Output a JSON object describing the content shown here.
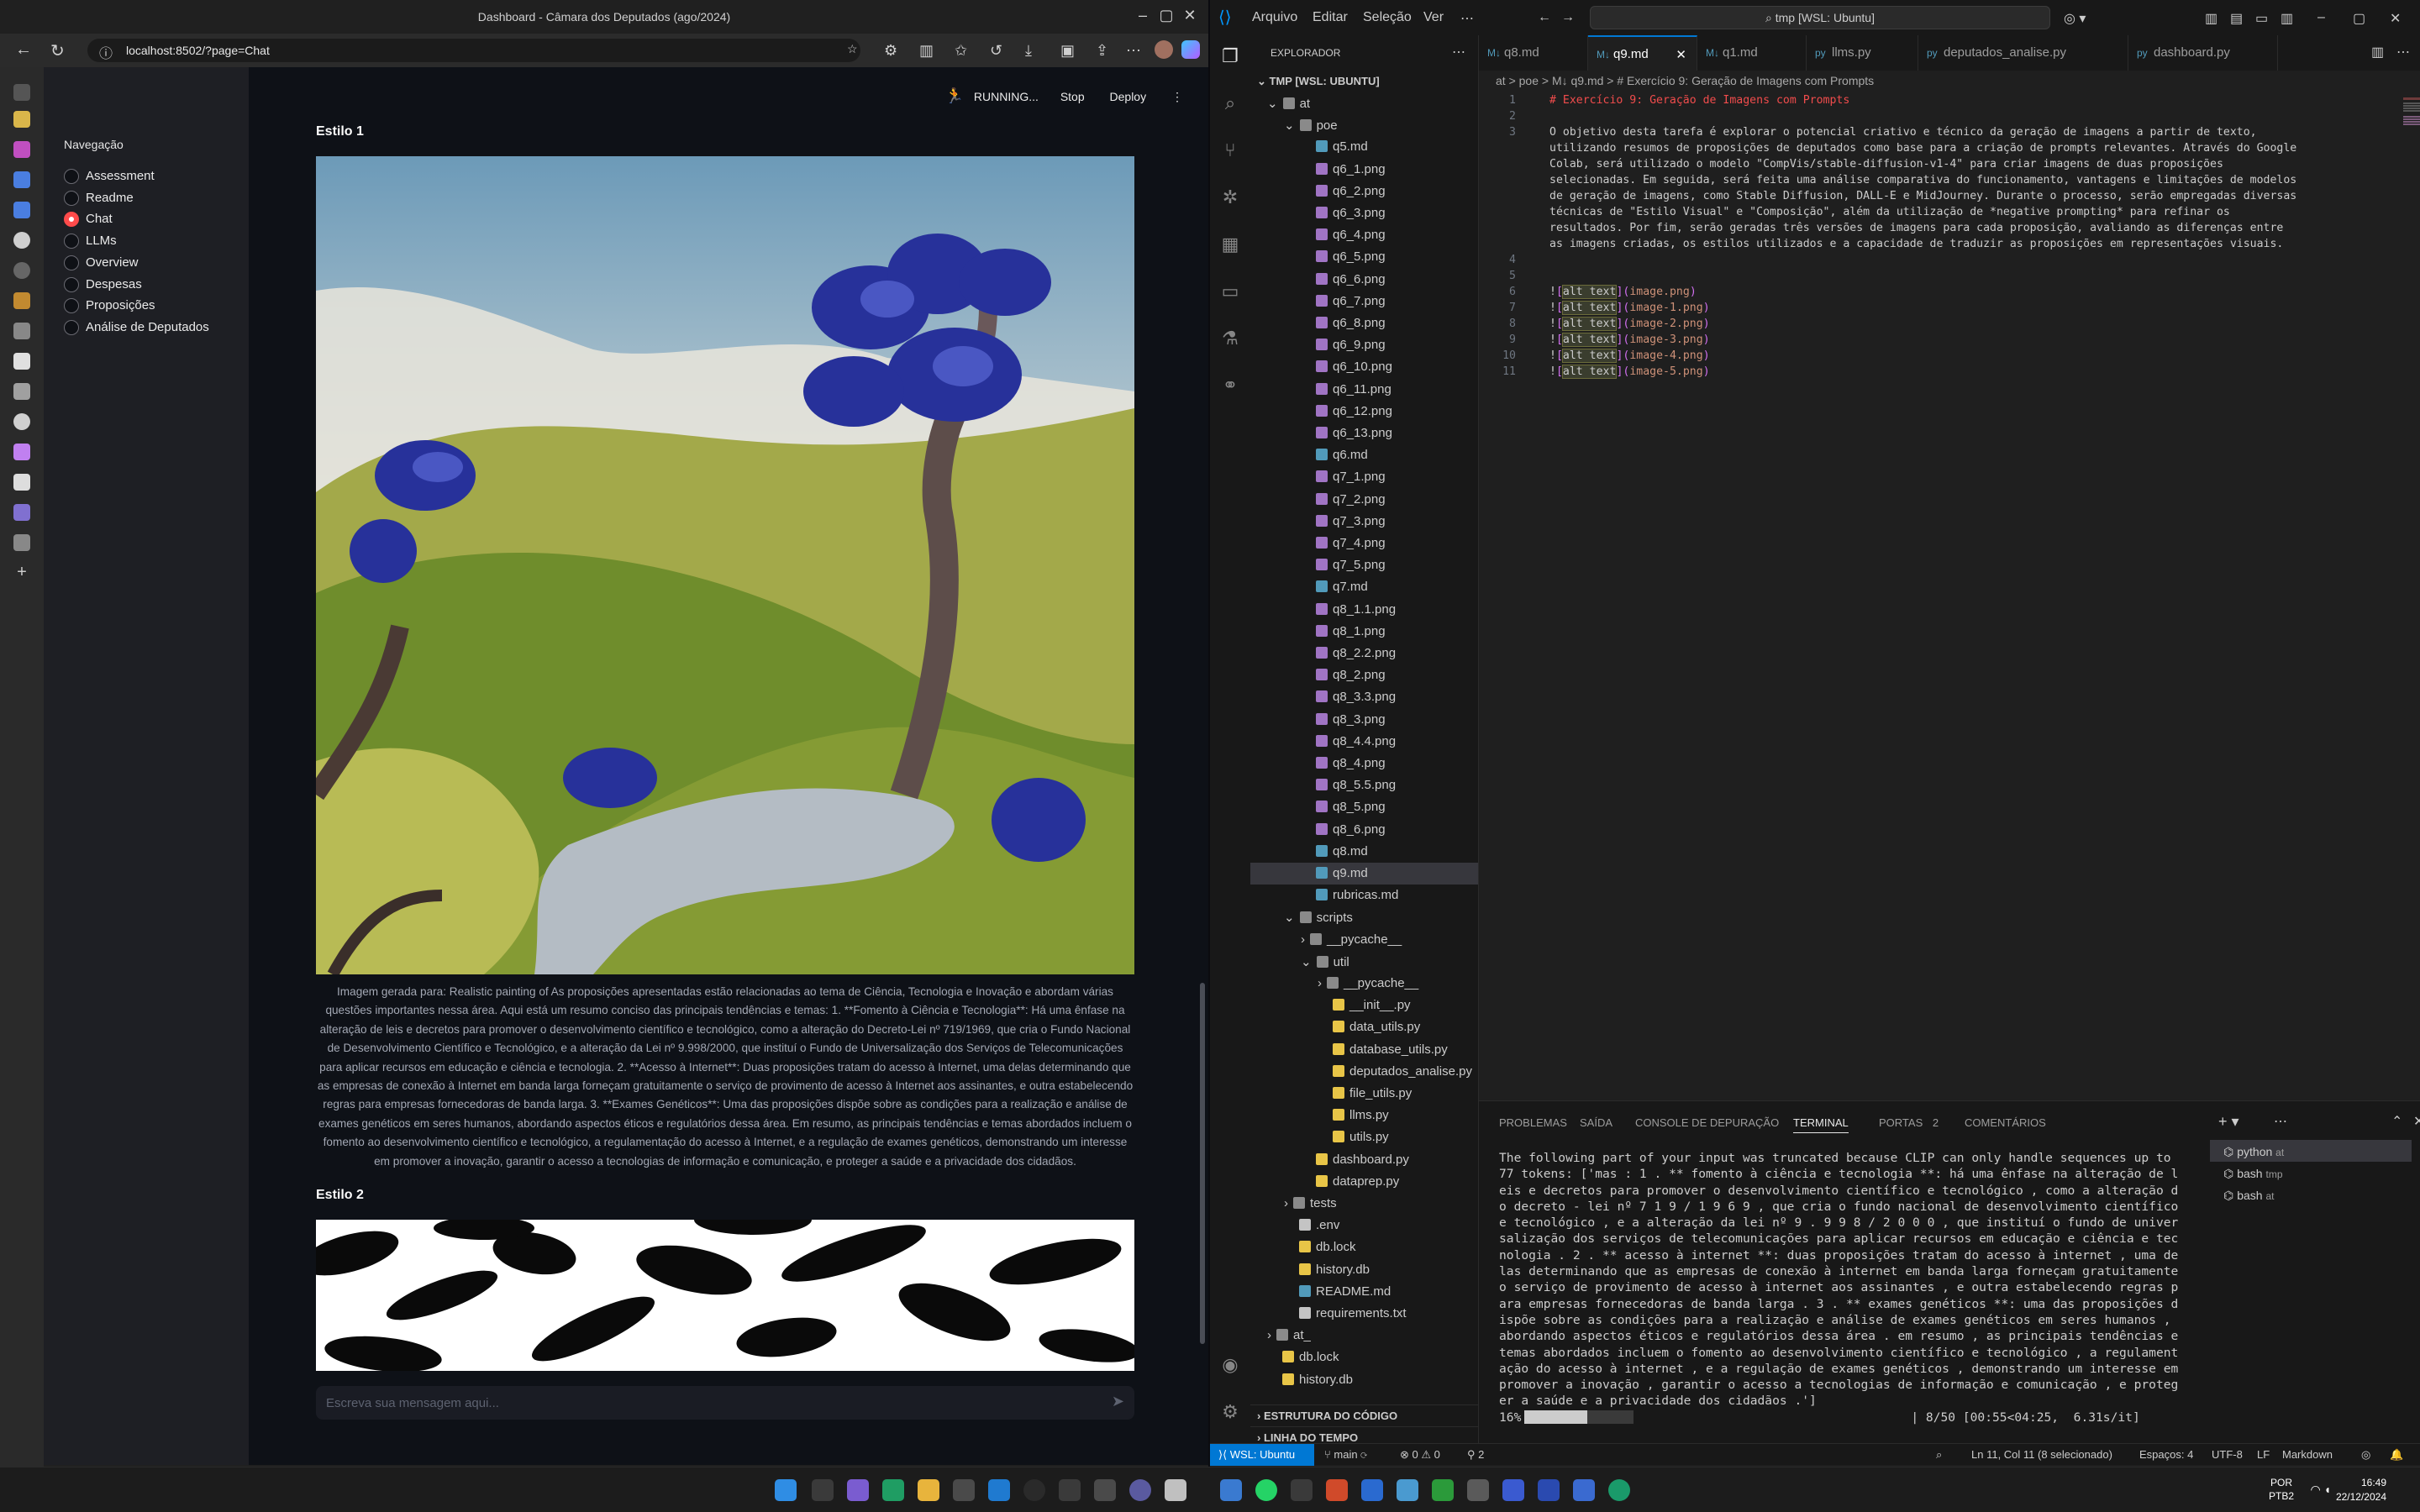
{
  "browser": {
    "window_title": "Dashboard - Câmara dos Deputados (ago/2024)",
    "url": "localhost:8502/?page=Chat"
  },
  "streamlit": {
    "status": "RUNNING...",
    "stop_label": "Stop",
    "deploy_label": "Deploy",
    "nav_heading": "Navegação",
    "nav_items": [
      "Assessment",
      "Readme",
      "Chat",
      "LLMs",
      "Overview",
      "Despesas",
      "Proposições",
      "Análise de Deputados"
    ],
    "nav_selected": "Chat",
    "style1_heading": "Estilo 1",
    "style2_heading": "Estilo 2",
    "caption": "Imagem gerada para: Realistic painting of As proposições apresentadas estão relacionadas ao tema de Ciência, Tecnologia e Inovação e abordam várias questões importantes nessa área. Aqui está um resumo conciso das principais tendências e temas: 1. **Fomento à Ciência e Tecnologia**: Há uma ênfase na alteração de leis e decretos para promover o desenvolvimento científico e tecnológico, como a alteração do Decreto-Lei nº 719/1969, que cria o Fundo Nacional de Desenvolvimento Científico e Tecnológico, e a alteração da Lei nº 9.998/2000, que instituí o Fundo de Universalização dos Serviços de Telecomunicações para aplicar recursos em educação e ciência e tecnologia. 2. **Acesso à Internet**: Duas proposições tratam do acesso à Internet, uma delas determinando que as empresas de conexão à Internet em banda larga forneçam gratuitamente o serviço de provimento de acesso à Internet aos assinantes, e outra estabelecendo regras para empresas fornecedoras de banda larga. 3. **Exames Genéticos**: Uma das proposições dispõe sobre as condições para a realização e análise de exames genéticos em seres humanos, abordando aspectos éticos e regulatórios dessa área. Em resumo, as principais tendências e temas abordados incluem o fomento ao desenvolvimento científico e tecnológico, a regulamentação do acesso à Internet, e a regulação de exames genéticos, demonstrando um interesse em promover a inovação, garantir o acesso a tecnologias de informação e comunicação, e proteger a saúde e a privacidade dos cidadãos.",
    "chat_placeholder": "Escreva sua mensagem aqui..."
  },
  "vscode": {
    "menu": [
      "Arquivo",
      "Editar",
      "Seleção",
      "Ver"
    ],
    "search": "tmp [WSL: Ubuntu]",
    "tabs": [
      {
        "label": "q8.md",
        "icon": "M↓"
      },
      {
        "label": "q9.md",
        "icon": "M↓"
      },
      {
        "label": "q1.md",
        "icon": "M↓"
      },
      {
        "label": "llms.py",
        "icon": "py"
      },
      {
        "label": "deputados_analise.py",
        "icon": "py"
      },
      {
        "label": "dashboard.py",
        "icon": "py"
      }
    ],
    "active_tab": "q9.md",
    "breadcrumb": "at  >  poe  >  M↓ q9.md  >  # Exercício 9: Geração de Imagens com Prompts",
    "explorer_title": "EXPLORADOR",
    "workspace": "TMP [WSL: UBUNTU]",
    "tree": [
      {
        "label": "at",
        "depth": 1,
        "kind": "folder-open"
      },
      {
        "label": "poe",
        "depth": 2,
        "kind": "folder-open"
      },
      {
        "label": "q5.md",
        "depth": 3,
        "kind": "md"
      },
      {
        "label": "q6_1.png",
        "depth": 3,
        "kind": "png"
      },
      {
        "label": "q6_2.png",
        "depth": 3,
        "kind": "png"
      },
      {
        "label": "q6_3.png",
        "depth": 3,
        "kind": "png"
      },
      {
        "label": "q6_4.png",
        "depth": 3,
        "kind": "png"
      },
      {
        "label": "q6_5.png",
        "depth": 3,
        "kind": "png"
      },
      {
        "label": "q6_6.png",
        "depth": 3,
        "kind": "png"
      },
      {
        "label": "q6_7.png",
        "depth": 3,
        "kind": "png"
      },
      {
        "label": "q6_8.png",
        "depth": 3,
        "kind": "png"
      },
      {
        "label": "q6_9.png",
        "depth": 3,
        "kind": "png"
      },
      {
        "label": "q6_10.png",
        "depth": 3,
        "kind": "png"
      },
      {
        "label": "q6_11.png",
        "depth": 3,
        "kind": "png"
      },
      {
        "label": "q6_12.png",
        "depth": 3,
        "kind": "png"
      },
      {
        "label": "q6_13.png",
        "depth": 3,
        "kind": "png"
      },
      {
        "label": "q6.md",
        "depth": 3,
        "kind": "md"
      },
      {
        "label": "q7_1.png",
        "depth": 3,
        "kind": "png"
      },
      {
        "label": "q7_2.png",
        "depth": 3,
        "kind": "png"
      },
      {
        "label": "q7_3.png",
        "depth": 3,
        "kind": "png"
      },
      {
        "label": "q7_4.png",
        "depth": 3,
        "kind": "png"
      },
      {
        "label": "q7_5.png",
        "depth": 3,
        "kind": "png"
      },
      {
        "label": "q7.md",
        "depth": 3,
        "kind": "md"
      },
      {
        "label": "q8_1.1.png",
        "depth": 3,
        "kind": "png"
      },
      {
        "label": "q8_1.png",
        "depth": 3,
        "kind": "png"
      },
      {
        "label": "q8_2.2.png",
        "depth": 3,
        "kind": "png"
      },
      {
        "label": "q8_2.png",
        "depth": 3,
        "kind": "png"
      },
      {
        "label": "q8_3.3.png",
        "depth": 3,
        "kind": "png"
      },
      {
        "label": "q8_3.png",
        "depth": 3,
        "kind": "png"
      },
      {
        "label": "q8_4.4.png",
        "depth": 3,
        "kind": "png"
      },
      {
        "label": "q8_4.png",
        "depth": 3,
        "kind": "png"
      },
      {
        "label": "q8_5.5.png",
        "depth": 3,
        "kind": "png"
      },
      {
        "label": "q8_5.png",
        "depth": 3,
        "kind": "png"
      },
      {
        "label": "q8_6.png",
        "depth": 3,
        "kind": "png"
      },
      {
        "label": "q8.md",
        "depth": 3,
        "kind": "md"
      },
      {
        "label": "q9.md",
        "depth": 3,
        "kind": "md",
        "selected": true
      },
      {
        "label": "rubricas.md",
        "depth": 3,
        "kind": "md"
      },
      {
        "label": "scripts",
        "depth": 2,
        "kind": "folder-open"
      },
      {
        "label": "__pycache__",
        "depth": 3,
        "kind": "folder"
      },
      {
        "label": "util",
        "depth": 3,
        "kind": "folder-open"
      },
      {
        "label": "__pycache__",
        "depth": 4,
        "kind": "folder"
      },
      {
        "label": "__init__.py",
        "depth": 4,
        "kind": "py"
      },
      {
        "label": "data_utils.py",
        "depth": 4,
        "kind": "py"
      },
      {
        "label": "database_utils.py",
        "depth": 4,
        "kind": "py"
      },
      {
        "label": "deputados_analise.py",
        "depth": 4,
        "kind": "py"
      },
      {
        "label": "file_utils.py",
        "depth": 4,
        "kind": "py"
      },
      {
        "label": "llms.py",
        "depth": 4,
        "kind": "py"
      },
      {
        "label": "utils.py",
        "depth": 4,
        "kind": "py"
      },
      {
        "label": "dashboard.py",
        "depth": 3,
        "kind": "py"
      },
      {
        "label": "dataprep.py",
        "depth": 3,
        "kind": "py"
      },
      {
        "label": "tests",
        "depth": 2,
        "kind": "folder"
      },
      {
        "label": ".env",
        "depth": 2,
        "kind": "env"
      },
      {
        "label": "db.lock",
        "depth": 2,
        "kind": "lock"
      },
      {
        "label": "history.db",
        "depth": 2,
        "kind": "db"
      },
      {
        "label": "README.md",
        "depth": 2,
        "kind": "info"
      },
      {
        "label": "requirements.txt",
        "depth": 2,
        "kind": "txt"
      },
      {
        "label": "at_",
        "depth": 1,
        "kind": "folder"
      },
      {
        "label": "db.lock",
        "depth": 1,
        "kind": "lock"
      },
      {
        "label": "history.db",
        "depth": 1,
        "kind": "db"
      }
    ],
    "outline_section": "ESTRUTURA DO CÓDIGO",
    "timeline_section": "LINHA DO TEMPO",
    "editor_lines": [
      {
        "n": "1",
        "text": "# Exercício 9: Geração de Imagens com Prompts",
        "kind": "heading"
      },
      {
        "n": "2",
        "text": "",
        "kind": "plain"
      },
      {
        "n": "3",
        "text": "O objetivo desta tarefa é explorar o potencial criativo e técnico da geração de imagens a partir de texto,",
        "kind": "plain"
      },
      {
        "n": "",
        "text": "utilizando resumos de proposições de deputados como base para a criação de prompts relevantes. Através do Google",
        "kind": "plain"
      },
      {
        "n": "",
        "text": "Colab, será utilizado o modelo \"CompVis/stable-diffusion-v1-4\" para criar imagens de duas proposições",
        "kind": "plain"
      },
      {
        "n": "",
        "text": "selecionadas. Em seguida, será feita uma análise comparativa do funcionamento, vantagens e limitações de modelos",
        "kind": "plain"
      },
      {
        "n": "",
        "text": "de geração de imagens, como Stable Diffusion, DALL-E e MidJourney. Durante o processo, serão empregadas diversas",
        "kind": "plain"
      },
      {
        "n": "",
        "text": "técnicas de \"Estilo Visual\" e \"Composição\", além da utilização de *negative prompting* para refinar os",
        "kind": "plain"
      },
      {
        "n": "",
        "text": "resultados. Por fim, serão geradas três versões de imagens para cada proposição, avaliando as diferenças entre",
        "kind": "plain"
      },
      {
        "n": "",
        "text": "as imagens criadas, os estilos utilizados e a capacidade de traduzir as proposições em representações visuais.",
        "kind": "plain"
      },
      {
        "n": "4",
        "text": "",
        "kind": "plain"
      },
      {
        "n": "5",
        "text": "",
        "kind": "plain"
      },
      {
        "n": "6",
        "text": "image.png",
        "kind": "img"
      },
      {
        "n": "7",
        "text": "image-1.png",
        "kind": "img"
      },
      {
        "n": "8",
        "text": "image-2.png",
        "kind": "img"
      },
      {
        "n": "9",
        "text": "image-3.png",
        "kind": "img"
      },
      {
        "n": "10",
        "text": "image-4.png",
        "kind": "img"
      },
      {
        "n": "11",
        "text": "image-5.png",
        "kind": "img"
      }
    ],
    "alt_text": "alt text",
    "panel_tabs": [
      "PROBLEMAS",
      "SAÍDA",
      "CONSOLE DE DEPURAÇÃO",
      "TERMINAL",
      "PORTAS",
      "COMENTÁRIOS"
    ],
    "ports_count": "2",
    "terminal_text": "The following part of your input was truncated because CLIP can only handle sequences up to 77 tokens: ['mas : 1 . ** fomento à ciência e tecnologia **: há uma ênfase na alteração de leis e decretos para promover o desenvolvimento científico e tecnológico , como a alteração do decreto - lei nº 7 1 9 / 1 9 6 9 , que cria o fundo nacional de desenvolvimento científico e tecnológico , e a alteração da lei nº 9 . 9 9 8 / 2 0 0 0 , que instituí o fundo de universalização dos serviços de telecomunicações para aplicar recursos em educação e ciência e tecnologia . 2 . ** acesso à internet **: duas proposições tratam do acesso à internet , uma delas determinando que as empresas de conexão à internet em banda larga forneçam gratuitamente o serviço de provimento de acesso à internet aos assinantes , e outra estabelecendo regras para empresas fornecedoras de banda larga . 3 . ** exames genéticos **: uma das proposições dispõe sobre as condições para a realização e análise de exames genéticos em seres humanos , abordando aspectos éticos e regulatórios dessa área . em resumo , as principais tendências e temas abordados incluem o fomento ao desenvolvimento científico e tecnológico , a regulamentação do acesso à internet , e a regulação de exames genéticos , demonstrando um interesse em promover a inovação , garantir o acesso a tecnologias de informação e comunicação , e proteger a saúde e a privacidade dos cidadãos .']",
    "progress_text": "| 8/50 [00:55<04:25,  6.31s/it]",
    "progress_percent_label": "16%",
    "progress_fraction": 0.16,
    "terminals": [
      {
        "name": "python",
        "cwd": "at"
      },
      {
        "name": "bash",
        "cwd": "tmp"
      },
      {
        "name": "bash",
        "cwd": "at"
      }
    ],
    "status": {
      "remote": "WSL: Ubuntu",
      "branch": "main",
      "problems": "0",
      "warnings": "0",
      "ports": "2",
      "cursor": "Ln 11, Col 11 (8 selecionado)",
      "spaces": "Espaços: 4",
      "encoding": "UTF-8",
      "eol": "LF",
      "language": "Markdown"
    }
  },
  "taskbar": {
    "lang": "POR",
    "layout": "PTB2",
    "time": "16:49",
    "date": "22/12/2024"
  }
}
